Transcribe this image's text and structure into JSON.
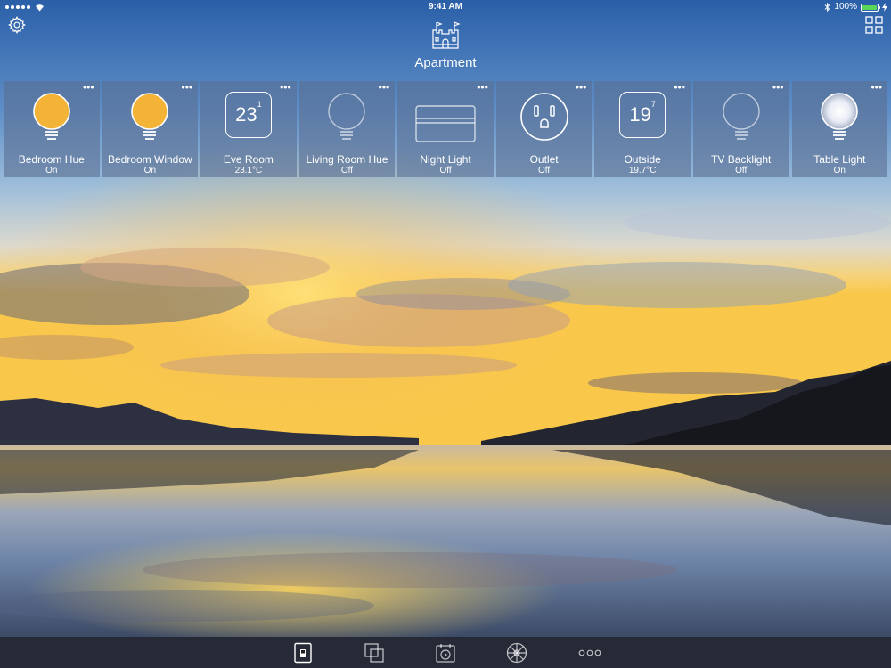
{
  "status_bar": {
    "time": "9:41 AM",
    "battery": "100%",
    "battery_level": 1.0,
    "signal_dots": 5,
    "icons": [
      "signal-dots-icon",
      "wifi-icon",
      "bluetooth-icon",
      "battery-icon",
      "charging-bolt-icon"
    ]
  },
  "header": {
    "title": "Apartment",
    "left_icon": "gear-icon",
    "right_icon": "grid-icon",
    "home_icon": "castle-icon"
  },
  "tiles": [
    {
      "name": "Bedroom Hue",
      "state": "On",
      "icon": "bulb-icon",
      "bulb_color": "#f2b336",
      "active": true
    },
    {
      "name": "Bedroom Window",
      "state": "On",
      "icon": "bulb-icon",
      "bulb_color": "#f2b336",
      "active": true
    },
    {
      "name": "Eve Room",
      "state": "23.1°C",
      "icon": "thermometer-display",
      "temp_whole": "23",
      "temp_decimal": "1"
    },
    {
      "name": "Living Room Hue",
      "state": "Off",
      "icon": "bulb-icon",
      "active": false
    },
    {
      "name": "Night Light",
      "state": "Off",
      "icon": "light-strip-icon",
      "active": false
    },
    {
      "name": "Outlet",
      "state": "Off",
      "icon": "outlet-icon",
      "active": false
    },
    {
      "name": "Outside",
      "state": "19.7°C",
      "icon": "thermometer-display",
      "temp_whole": "19",
      "temp_decimal": "7"
    },
    {
      "name": "TV Backlight",
      "state": "Off",
      "icon": "bulb-icon",
      "active": false
    },
    {
      "name": "Table Light",
      "state": "On",
      "icon": "bulb-icon",
      "bulb_color": "#e8ecf5",
      "active": true
    }
  ],
  "tile_more_label": "•••",
  "tab_bar": {
    "tabs": [
      {
        "icon": "accessories-tab-icon",
        "selected": true
      },
      {
        "icon": "scenes-tab-icon",
        "selected": false
      },
      {
        "icon": "timers-tab-icon",
        "selected": false
      },
      {
        "icon": "rooms-tab-icon",
        "selected": false
      },
      {
        "icon": "more-tab-icon",
        "selected": false
      }
    ]
  },
  "colors": {
    "tile_background": "rgba(90,110,145,0.60)",
    "bulb_on_warm": "#f2b336",
    "bulb_on_cool": "#e8ecf5",
    "tab_bar_background": "#1e1e23",
    "battery_fill": "#5ad65a"
  }
}
